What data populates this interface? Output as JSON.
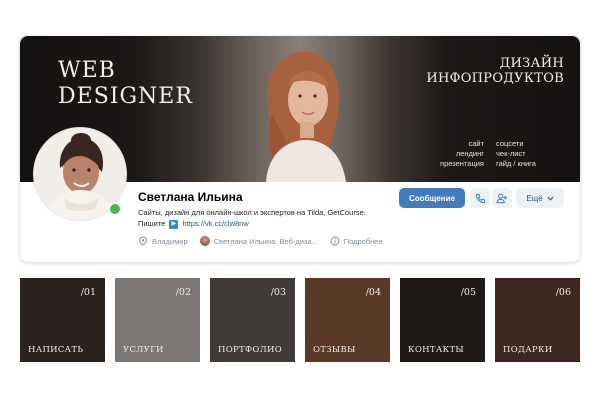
{
  "cover": {
    "title_line1": "WEB",
    "title_line2": "DESIGNER",
    "right_title_line1": "ДИЗАЙН",
    "right_title_line2": "ИНФОПРОДУКТОВ",
    "list_a": [
      "сайт",
      "лендинг",
      "презентация"
    ],
    "list_b": [
      "соцсети",
      "чек-лист",
      "гайд / книга"
    ]
  },
  "profile": {
    "name": "Светлана Ильина",
    "status_line1": "Сайты, дизайн для онлайн-школ и экспертов на Tilda, GetCourse.",
    "status_line2_prefix": "Пишите",
    "status_link": "https://vk.cc/clw8nw",
    "city": "Владимир",
    "work": "Светлана Ильина. Веб-диза...",
    "details": "Подробнее",
    "online": true
  },
  "actions": {
    "message_label": "Сообщение",
    "more_label": "Ещё"
  },
  "tiles": [
    {
      "num": "/01",
      "label": "НАПИСАТЬ",
      "color": "#2a221f"
    },
    {
      "num": "/02",
      "label": "УСЛУГИ",
      "color": "#7c7774"
    },
    {
      "num": "/03",
      "label": "ПОРТФОЛИО",
      "color": "#403b38"
    },
    {
      "num": "/04",
      "label": "ОТЗЫВЫ",
      "color": "#5a3828"
    },
    {
      "num": "/05",
      "label": "КОНТАКТЫ",
      "color": "#1f1a18"
    },
    {
      "num": "/06",
      "label": "ПОДАРКИ",
      "color": "#3d281f"
    }
  ],
  "colors": {
    "accent": "#447bba",
    "link": "#2a5885",
    "online": "#4bb34b",
    "secondary_text": "#818c99",
    "secondary_button": "#eef2f7"
  },
  "icons": [
    "location-pin-icon",
    "work-avatar-icon",
    "info-icon",
    "phone-icon",
    "add-friend-icon",
    "chevron-down-icon",
    "arrow-emoji-icon"
  ]
}
